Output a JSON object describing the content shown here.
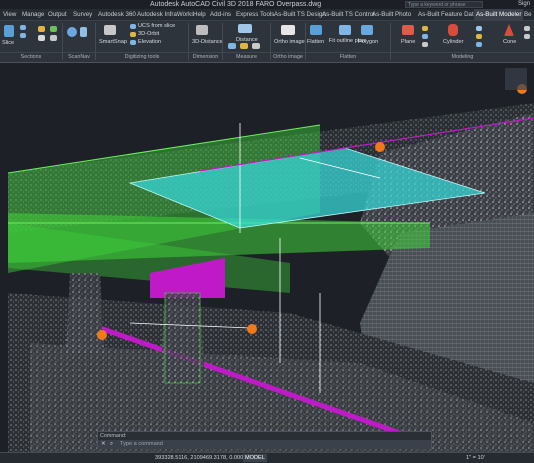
{
  "window": {
    "title": "Autodesk AutoCAD Civil 3D 2018    FARO Overpass.dwg",
    "search_placeholder": "Type a keyword or phrase",
    "signin": "Sign"
  },
  "tabs": [
    "View",
    "Manage",
    "Output",
    "Survey",
    "Autodesk 360",
    "Autodesk InfraWorks",
    "Help",
    "Add-ins",
    "Express Tools",
    "As-Built TS Design",
    "As-Built TS Control",
    "As-Built Photo",
    "As-Built Feature Data",
    "As-Built Modeler",
    "Be"
  ],
  "active_tab": "As-Built Modeler",
  "ribbon": {
    "buttons": {
      "slice": "Slice",
      "smartsnap": "SmartSnap",
      "ucs_from_slice": "UCS from slice",
      "orbit": "3D-Orbit",
      "elevation": "Elevation",
      "distance3d": "3D-Distance",
      "distance": "Distance",
      "ortho_image": "Ortho image",
      "flatten": "Flatten",
      "fit_outline_plan": "Fit outline plan",
      "polygon": "Polygon",
      "plane": "Plane",
      "cylinder": "Cylinder",
      "cone": "Cone"
    },
    "groups": {
      "sections": "Sections",
      "scannav": "ScanNav",
      "digitizing": "Digitizing tools",
      "dimension": "Dimension",
      "measure_diff": "Measure differences",
      "ortho": "Ortho image",
      "flatten": "Flatten",
      "modeling": "Modeling"
    }
  },
  "command": {
    "history": "Command:",
    "prompt": "Type a command"
  },
  "status": {
    "coords": "393328.5116, 2109469.3178, 0.0000",
    "model": "MODEL",
    "scale": "1\" = 10'"
  },
  "colors": {
    "accent": "#3a414b",
    "cyan_plane": "#37d6d6",
    "green_mesh": "#3fd23a",
    "magenta": "#c01ac8",
    "marker": "#f07a1a"
  }
}
